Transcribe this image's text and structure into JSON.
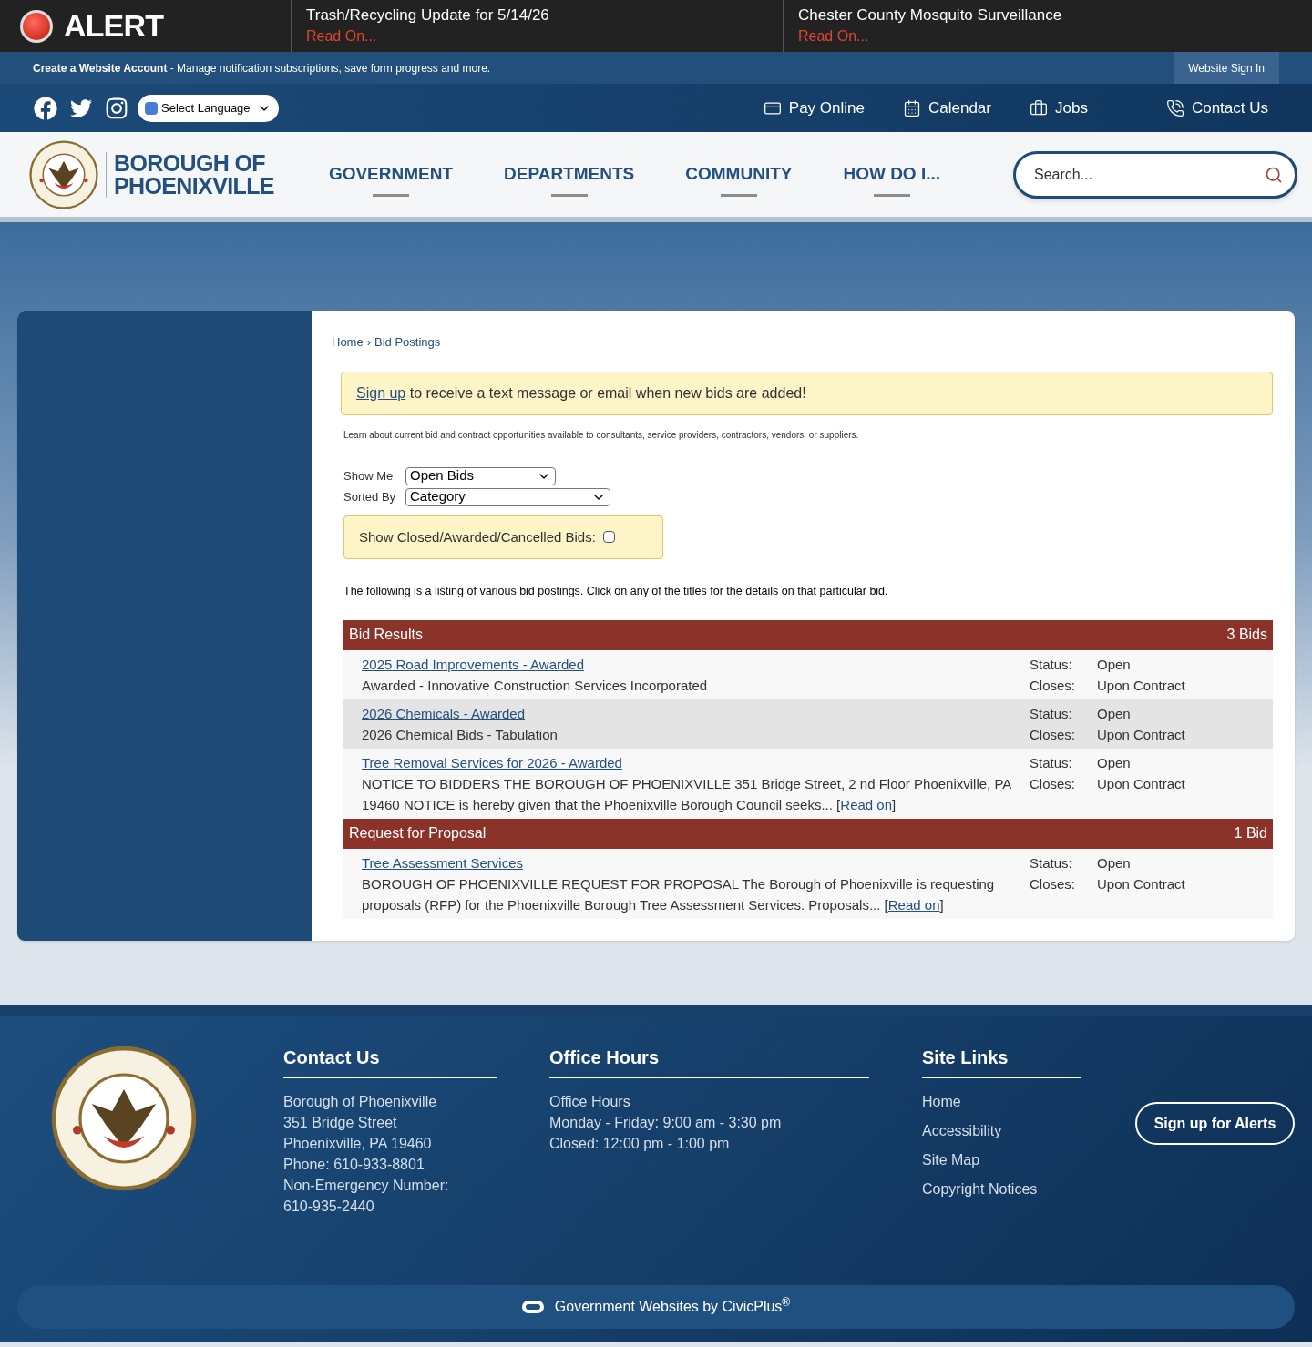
{
  "alert_bar": {
    "label": "ALERT",
    "items": [
      {
        "title": "Trash/Recycling Update for 5/14/26",
        "link": "Read On..."
      },
      {
        "title": "Chester County Mosquito Surveillance",
        "link": "Read On..."
      }
    ]
  },
  "account_bar": {
    "link": "Create a Website Account",
    "text": " - Manage notification subscriptions, save form progress and more.",
    "sign_in": "Website Sign In"
  },
  "utility_bar": {
    "language": "Select Language",
    "links": [
      {
        "kind": "card",
        "label": "Pay Online"
      },
      {
        "kind": "calendar",
        "label": "Calendar"
      },
      {
        "kind": "briefcase",
        "label": "Jobs"
      },
      {
        "kind": "phone",
        "label": "Contact Us"
      }
    ]
  },
  "header": {
    "brand": [
      "BOROUGH OF",
      "PHOENIXVILLE"
    ],
    "nav": [
      "GOVERNMENT",
      "DEPARTMENTS",
      "COMMUNITY",
      "HOW DO I..."
    ],
    "search": {
      "placeholder": "Search..."
    }
  },
  "content": {
    "breadcrumb": {
      "items": [
        "Home",
        "Bid Postings"
      ],
      "separator": "›"
    },
    "notice": {
      "link": "Sign up",
      "text": " to receive a text message or email when new bids are added!"
    },
    "intro": "Learn about current bid and contract opportunities available to consultants, service providers, contractors, vendors, or suppliers.",
    "filters": [
      {
        "label": "Show Me",
        "value": "Open Bids"
      },
      {
        "label": "Sorted By",
        "value": "Category"
      }
    ],
    "closed_toggle": {
      "label": "Show Closed/Awarded/Cancelled Bids:",
      "checked": false
    },
    "listing_intro": "The following is a listing of various bid postings. Click on any of the titles for the details on that particular bid.",
    "categories": [
      {
        "name": "Bid Results",
        "count": "3 Bids",
        "bids": [
          {
            "title": "2025 Road Improvements - Awarded",
            "description": "Awarded - Innovative Construction Services Incorporated",
            "status_label": "Status:",
            "status": "Open",
            "closes_label": "Closes:",
            "closes": "Upon Contract"
          },
          {
            "title": "2026 Chemicals - Awarded",
            "description": "2026 Chemical Bids - Tabulation",
            "status_label": "Status:",
            "status": "Open",
            "closes_label": "Closes:",
            "closes": "Upon Contract"
          },
          {
            "title": "Tree Removal Services for 2026 - Awarded",
            "description": "NOTICE TO BIDDERS THE BOROUGH OF PHOENIXVILLE 351 Bridge Street, 2 nd Floor Phoenixville, PA 19460 NOTICE is hereby given that the Phoenixville Borough Council seeks... [",
            "read_on": "Read on",
            "after": "]",
            "status_label": "Status:",
            "status": "Open",
            "closes_label": "Closes:",
            "closes": "Upon Contract"
          }
        ]
      },
      {
        "name": "Request for Proposal",
        "count": "1 Bid",
        "bids": [
          {
            "title": "Tree Assessment Services",
            "description": "BOROUGH OF PHOENIXVILLE REQUEST FOR PROPOSAL The Borough of Phoenixville is requesting proposals (RFP) for the Phoenixville Borough Tree Assessment Services. Proposals... [",
            "read_on": "Read on",
            "after": "]",
            "status_label": "Status:",
            "status": "Open",
            "closes_label": "Closes:",
            "closes": "Upon Contract"
          }
        ]
      }
    ]
  },
  "footer": {
    "contact": {
      "heading": "Contact Us",
      "lines": [
        "Borough of Phoenixville",
        "351 Bridge Street",
        "Phoenixville, PA 19460",
        "Phone: 610-933-8801",
        "Non-Emergency Number:",
        "610-935-2440"
      ]
    },
    "hours": {
      "heading": "Office Hours",
      "lines": [
        "Office Hours",
        "Monday - Friday: 9:00 am - 3:30 pm",
        "Closed: 12:00 pm - 1:00 pm"
      ]
    },
    "site_links": {
      "heading": "Site Links",
      "items": [
        "Home",
        "Accessibility",
        "Site Map",
        "Copyright Notices"
      ]
    },
    "alerts_button": "Sign up for Alerts",
    "credit": "Government Websites by CivicPlus$^{®}$"
  }
}
